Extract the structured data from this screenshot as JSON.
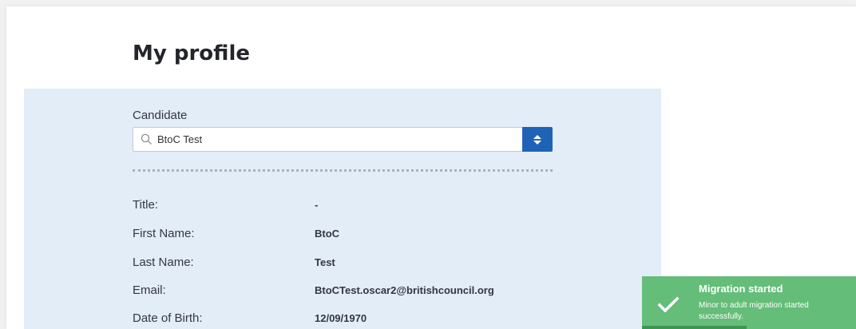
{
  "page": {
    "title": "My profile"
  },
  "candidate": {
    "label": "Candidate",
    "selected": "BtoC Test",
    "icons": {
      "search": "search-icon",
      "toggle": "up-down-chevron-icon"
    }
  },
  "profile": {
    "fields": [
      {
        "label": "Title:",
        "value": "-"
      },
      {
        "label": "First Name:",
        "value": "BtoC"
      },
      {
        "label": "Last Name:",
        "value": "Test"
      },
      {
        "label": "Email:",
        "value": "BtoCTest.oscar2@britishcouncil.org"
      },
      {
        "label": "Date of Birth:",
        "value": "12/09/1970"
      }
    ]
  },
  "toast": {
    "title": "Migration started",
    "message": "Minor to adult migration started successfully.",
    "icon": "check-icon",
    "progress": 0.49
  },
  "colors": {
    "panel_bg": "#e3edf7",
    "accent_blue": "#1f63b7",
    "toast_green": "#64bd78",
    "toast_progress": "#3f9553"
  }
}
